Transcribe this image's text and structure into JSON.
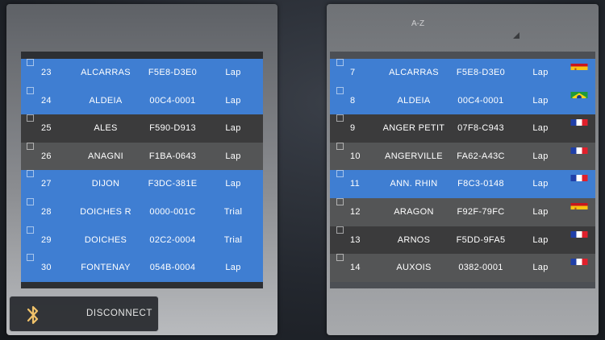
{
  "left_list": {
    "rows": [
      {
        "num": "23",
        "name": "ALCARRAS",
        "code": "F5E8-D3E0",
        "type": "Lap",
        "style": "blue"
      },
      {
        "num": "24",
        "name": "ALDEIA",
        "code": "00C4-0001",
        "type": "Lap",
        "style": "blue"
      },
      {
        "num": "25",
        "name": "ALES",
        "code": "F590-D913",
        "type": "Lap",
        "style": "dark"
      },
      {
        "num": "26",
        "name": "ANAGNI",
        "code": "F1BA-0643",
        "type": "Lap",
        "style": "mid"
      },
      {
        "num": "27",
        "name": "DIJON",
        "code": "F3DC-381E",
        "type": "Lap",
        "style": "blue"
      },
      {
        "num": "28",
        "name": "DOICHES R",
        "code": "0000-001C",
        "type": "Trial",
        "style": "blue"
      },
      {
        "num": "29",
        "name": "DOICHES",
        "code": "02C2-0004",
        "type": "Trial",
        "style": "blue"
      },
      {
        "num": "30",
        "name": "FONTENAY",
        "code": "054B-0004",
        "type": "Lap",
        "style": "blue"
      }
    ]
  },
  "right_list": {
    "sort_label": "A-Z",
    "rows": [
      {
        "num": "7",
        "name": "ALCARRAS",
        "code": "F5E8-D3E0",
        "type": "Lap",
        "style": "blue",
        "flag": "spain-flag-icon"
      },
      {
        "num": "8",
        "name": "ALDEIA",
        "code": "00C4-0001",
        "type": "Lap",
        "style": "blue",
        "flag": "brazil-flag-icon"
      },
      {
        "num": "9",
        "name": "ANGER PETIT",
        "code": "07F8-C943",
        "type": "Lap",
        "style": "dark",
        "flag": "france-flag-icon"
      },
      {
        "num": "10",
        "name": "ANGERVILLE",
        "code": "FA62-A43C",
        "type": "Lap",
        "style": "mid",
        "flag": "france-flag-icon"
      },
      {
        "num": "11",
        "name": "ANN. RHIN",
        "code": "F8C3-0148",
        "type": "Lap",
        "style": "blue",
        "flag": "france-flag-icon"
      },
      {
        "num": "12",
        "name": "ARAGON",
        "code": "F92F-79FC",
        "type": "Lap",
        "style": "mid",
        "flag": "spain-flag-icon"
      },
      {
        "num": "13",
        "name": "ARNOS",
        "code": "F5DD-9FA5",
        "type": "Lap",
        "style": "dark",
        "flag": "france-flag-icon"
      },
      {
        "num": "14",
        "name": "AUXOIS",
        "code": "0382-0001",
        "type": "Lap",
        "style": "mid",
        "flag": "france-flag-icon"
      }
    ]
  },
  "disconnect": {
    "label": "DISCONNECT",
    "icon": "bluetooth-icon"
  },
  "colors": {
    "selected": "#3f7ed2",
    "dark": "#3b3b3c",
    "mid": "#545556"
  }
}
